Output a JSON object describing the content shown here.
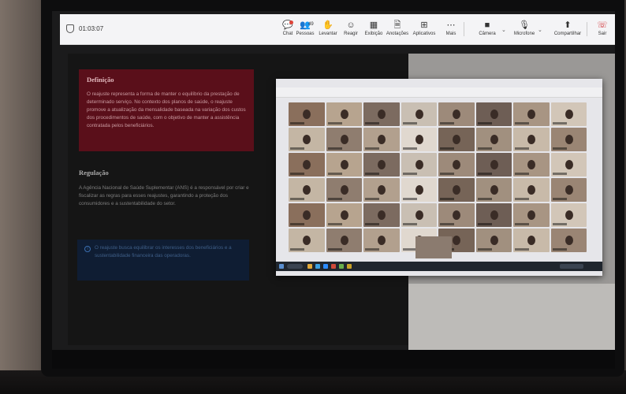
{
  "toolbar": {
    "timer": "01:03:07",
    "people_count": "49",
    "items": {
      "chat": "Chat",
      "people": "Pessoas",
      "raise": "Levantar",
      "react": "Reagir",
      "view": "Exibição",
      "notes": "Anotações",
      "apps": "Aplicativos",
      "more": "Mais",
      "camera": "Câmera",
      "mic": "Microfone",
      "share": "Compartilhar",
      "leave": "Sair"
    },
    "colors": {
      "leave": "#d13438",
      "badge": "#e0453a"
    }
  },
  "slide": {
    "definition_title": "Definição",
    "definition_text": "O reajuste representa a forma de manter o equilíbrio da prestação de determinado serviço. No contexto dos planos de saúde, o reajuste promove a atualização da mensalidade baseada na variação dos custos dos procedimentos de saúde, com o objetivo de manter a assistência contratada pelos beneficiários.",
    "regulation_title": "Regulação",
    "regulation_text": "A Agência Nacional de Saúde Suplementar (ANS) é a responsável por criar e fiscalizar as regras para esses reajustes, garantindo a proteção dos consumidores e a sustentabilidade do setor.",
    "info_text": "O reajuste busca equilibrar os interesses dos beneficiários e a sustentabilidade financeira das operadoras.",
    "colors": {
      "definition_bg": "#5a0f1a",
      "info_bg": "#0f1d33"
    }
  },
  "gallery": {
    "tile_colors": [
      "#8a6f5c",
      "#b7a48f",
      "#7c6b60",
      "#c9bfb3",
      "#9d8a7a",
      "#6e5e55",
      "#a89583",
      "#d2c6b8",
      "#c4b6a4",
      "#8f7d6f",
      "#b2a08e",
      "#e0d8cf",
      "#766457",
      "#a1907f",
      "#c8baa9",
      "#9a8574"
    ]
  }
}
